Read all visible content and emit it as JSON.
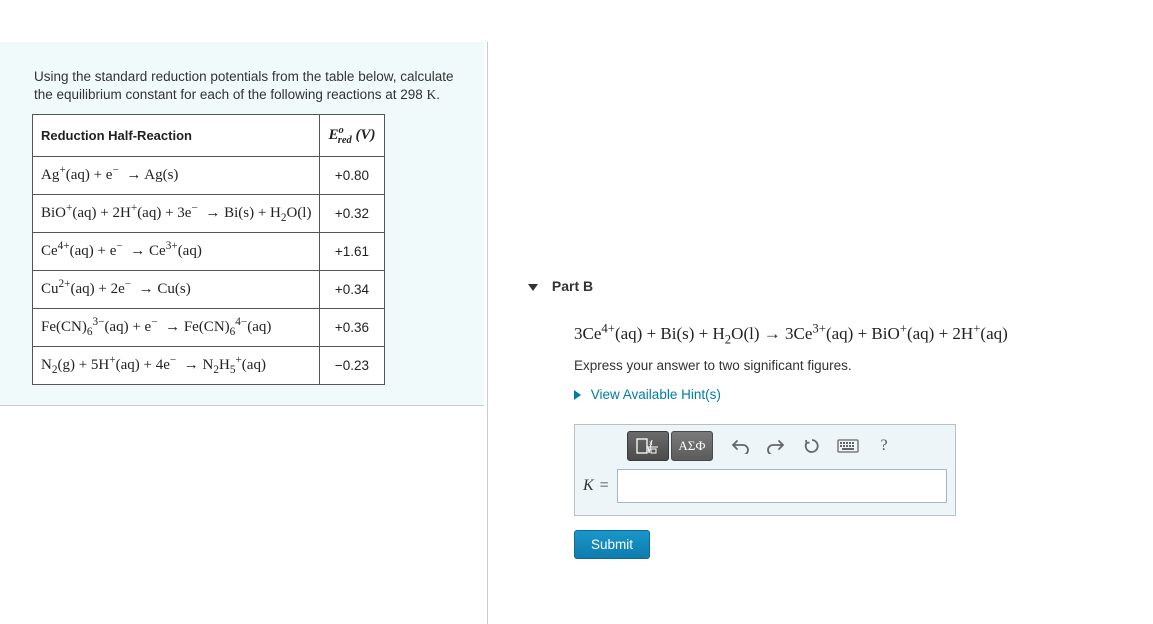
{
  "prompt": "Using the standard reduction potentials from the table below, calculate the equilibrium constant for each of the following reactions at 298 K.",
  "table": {
    "header_left": "Reduction Half-Reaction",
    "header_right_html": "E°_red (V)",
    "rows": [
      {
        "eq": "Ag⁺(aq) + e⁻ → Ag(s)",
        "v": "+0.80"
      },
      {
        "eq": "BiO⁺(aq) + 2H⁺(aq) + 3e⁻ → Bi(s) + H₂O(l)",
        "v": "+0.32"
      },
      {
        "eq": "Ce⁴⁺(aq) + e⁻ → Ce³⁺(aq)",
        "v": "+1.61"
      },
      {
        "eq": "Cu²⁺(aq) + 2e⁻ → Cu(s)",
        "v": "+0.34"
      },
      {
        "eq": "Fe(CN)₆³⁻(aq) + e⁻ → Fe(CN)₆⁴⁻(aq)",
        "v": "+0.36"
      },
      {
        "eq": "N₂(g) + 5H⁺(aq) + 4e⁻ → N₂H₅⁺(aq)",
        "v": "−0.23"
      }
    ]
  },
  "partB": {
    "label": "Part B",
    "equation": "3Ce⁴⁺(aq) + Bi(s) + H₂O(l) → 3Ce³⁺(aq) + BiO⁺(aq) + 2H⁺(aq)",
    "instruction": "Express your answer to two significant figures.",
    "hint_link": "View Available Hint(s)",
    "answer_label": "K",
    "answer_value": "",
    "submit": "Submit",
    "toolbar": {
      "templates": "templates",
      "greek": "ΑΣФ",
      "undo": "undo",
      "redo": "redo",
      "reset": "reset",
      "keyboard": "keyboard",
      "help": "?"
    }
  }
}
